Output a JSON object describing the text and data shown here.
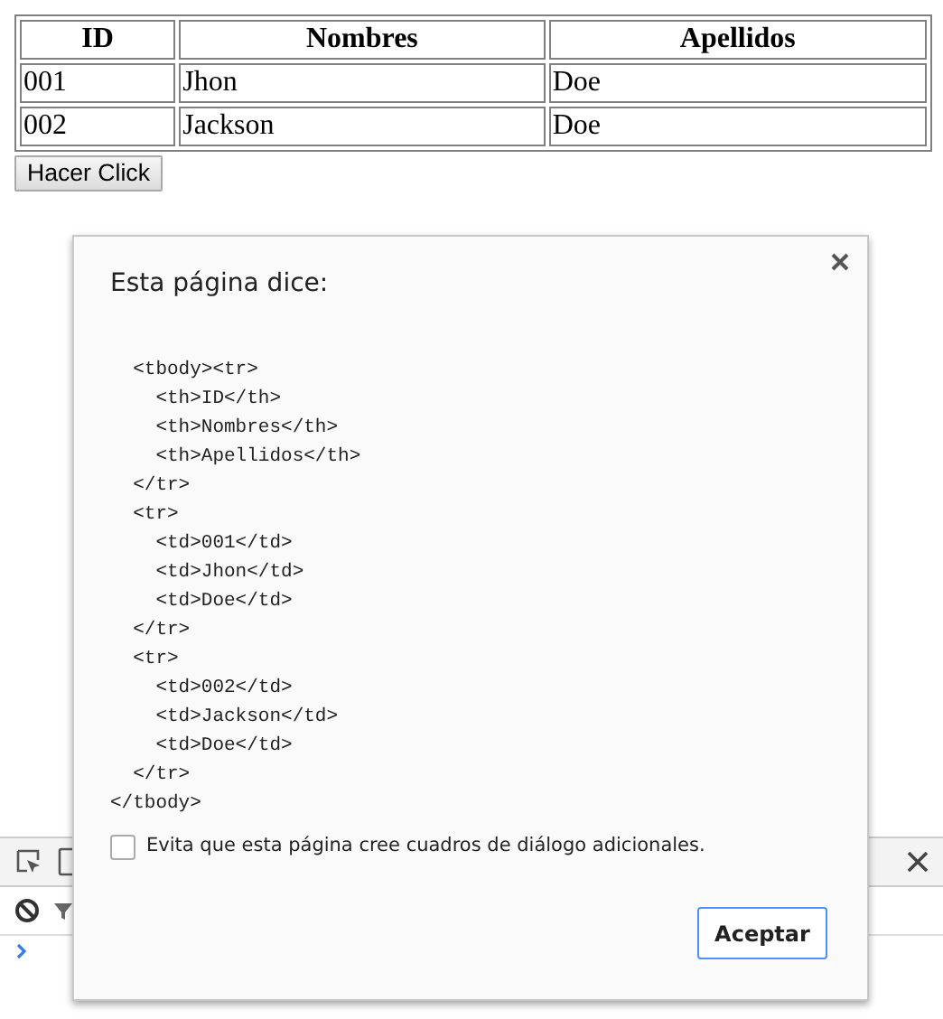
{
  "table": {
    "columns": [
      "ID",
      "Nombres",
      "Apellidos"
    ],
    "rows": [
      [
        "001",
        "Jhon",
        "Doe"
      ],
      [
        "002",
        "Jackson",
        "Doe"
      ]
    ]
  },
  "page_button": "Hacer Click",
  "dialog": {
    "title": "Esta página dice:",
    "message": "  <tbody><tr>\n    <th>ID</th>\n    <th>Nombres</th>\n    <th>Apellidos</th>\n  </tr>\n  <tr>\n    <td>001</td>\n    <td>Jhon</td>\n    <td>Doe</td>\n  </tr>\n  <tr>\n    <td>002</td>\n    <td>Jackson</td>\n    <td>Doe</td>\n  </tr>\n</tbody>",
    "suppress": {
      "label": "Evita que esta página cree cuadros de diálogo adicionales.",
      "checked": false
    },
    "ok_button": "Aceptar"
  }
}
